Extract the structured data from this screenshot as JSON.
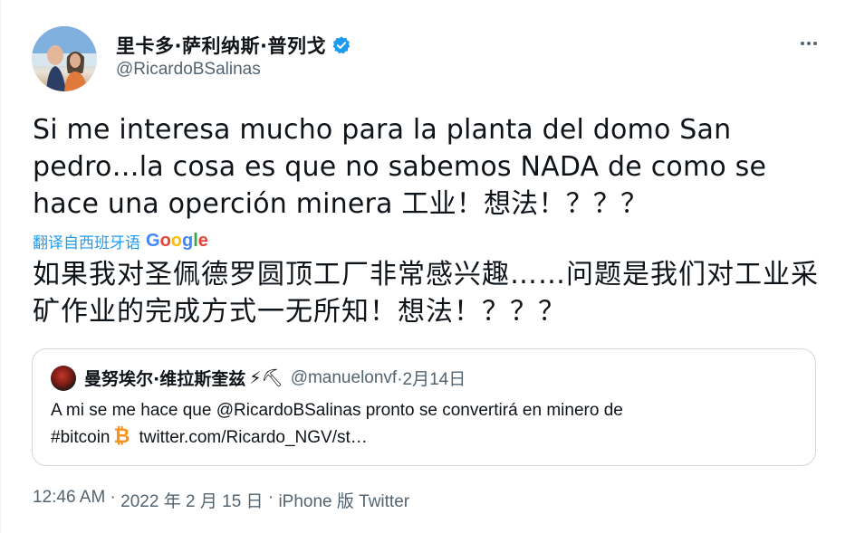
{
  "author": {
    "display_name": "里卡多·萨利纳斯·普列戈",
    "handle": "@RicardoBSalinas",
    "verified": true
  },
  "tweet": {
    "text": "Si me interesa mucho para la planta del domo San pedro…la cosa es que no sabemos NADA de como se hace una operción minera 工业！想法！？？？",
    "translate_label": "翻译自西班牙语",
    "translate_provider": "Google",
    "translated_text": "如果我对圣佩德罗圆顶工厂非常感兴趣……问题是我们对工业采矿作业的完成方式一无所知！想法！？？？"
  },
  "quoted_tweet": {
    "display_name": "曼努埃尔·维拉斯奎兹",
    "emoji": "⚡⛏",
    "handle": "@manuelonvf",
    "date": " ·2月14日",
    "text_line1": "A mi se me hace que @RicardoBSalinas pronto se convertirá en minero de",
    "hashtag": "#bitcoin",
    "btc_symbol": "₿",
    "link": "twitter.com/Ricardo_NGV/st…"
  },
  "meta": {
    "time": "12:46 AM",
    "separator1": " · ",
    "date": "2022 年 2 月 15 日",
    "separator2": " · ",
    "source": "iPhone 版 Twitter"
  },
  "icons": {
    "verified": "verified-badge-icon",
    "more": "more-horizontal-icon"
  },
  "colors": {
    "accent": "#1d9bf0",
    "secondary_text": "#536471",
    "border": "#cfd9de",
    "bitcoin": "#f7931a"
  }
}
